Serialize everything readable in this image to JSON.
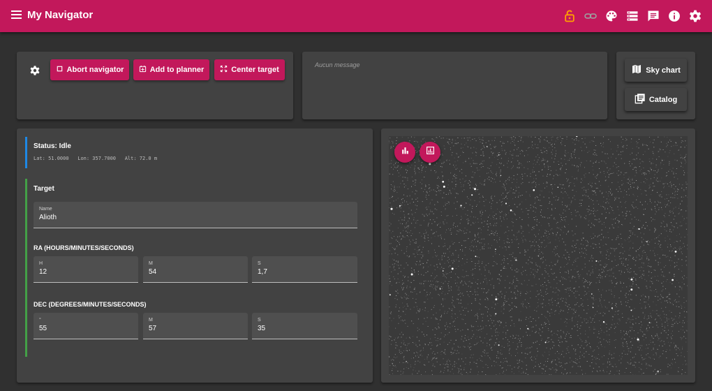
{
  "app": {
    "title": "My Navigator"
  },
  "header_icons": [
    {
      "name": "lock-open-icon",
      "color": "#ffa000"
    },
    {
      "name": "link-icon",
      "color": "#9e9e9e"
    },
    {
      "name": "palette-icon",
      "color": "#ffffff"
    },
    {
      "name": "storage-icon",
      "color": "#ffffff"
    },
    {
      "name": "feedback-icon",
      "color": "#ffffff"
    },
    {
      "name": "info-icon",
      "color": "#ffffff"
    },
    {
      "name": "settings-icon",
      "color": "#ffffff"
    }
  ],
  "toolbar": {
    "abort_label": "Abort navigator",
    "planner_label": "Add to planner",
    "center_label": "Center target"
  },
  "messages": {
    "empty_text": "Aucun message"
  },
  "side": {
    "sky_chart_label": "Sky chart",
    "catalog_label": "Catalog"
  },
  "status": {
    "title": "Status: Idle",
    "lat": "Lat: 51.0000",
    "lon": "Lon: 357.7000",
    "alt": "Alt: 72.0 m"
  },
  "target": {
    "title": "Target",
    "name_label": "Name",
    "name_value": "Alioth",
    "ra_title": "RA (HOURS/MINUTES/SECONDS)",
    "ra": [
      {
        "label": "H",
        "value": "12"
      },
      {
        "label": "M",
        "value": "54"
      },
      {
        "label": "S",
        "value": "1,7"
      }
    ],
    "dec_title": "DEC (DEGREES/MINUTES/SECONDS)",
    "dec": [
      {
        "label": "°",
        "value": "55"
      },
      {
        "label": "M",
        "value": "57"
      },
      {
        "label": "S",
        "value": "35"
      }
    ]
  },
  "colors": {
    "accent": "#c2185b",
    "status_bar": "#1e88e5",
    "target_bar": "#43a047"
  }
}
